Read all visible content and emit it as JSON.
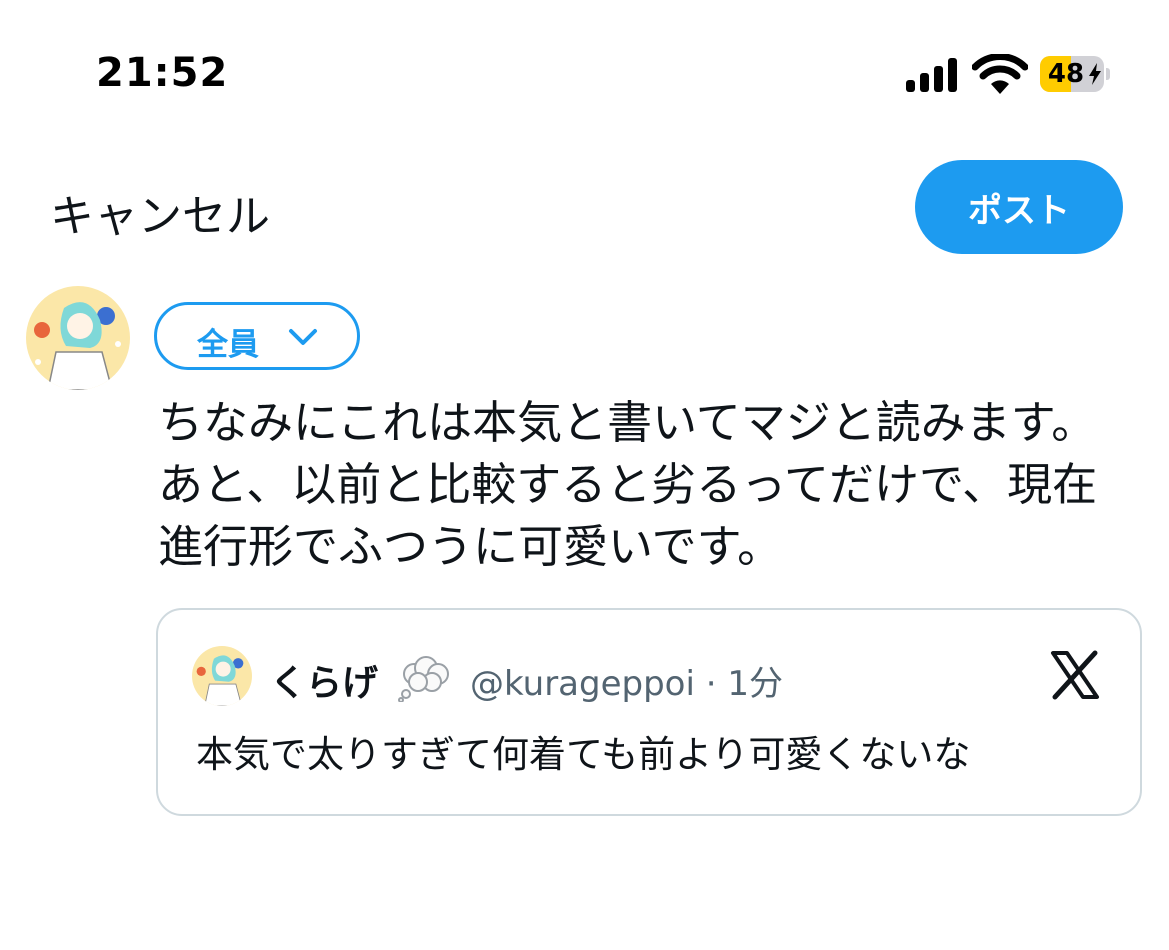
{
  "status_bar": {
    "time": "21:52",
    "battery_level": 48,
    "battery_text": "48",
    "battery_charging": true,
    "icons": [
      "cellular-signal-icon",
      "wifi-icon",
      "battery-icon",
      "charging-bolt-icon"
    ]
  },
  "nav": {
    "cancel_label": "キャンセル",
    "post_label": "ポスト"
  },
  "composer": {
    "audience_label": "全員",
    "text": "ちなみにこれは本気と書いてマジと読みます。あと、以前と比較すると劣るってだけで、現在進行形でふつうに可愛いです。"
  },
  "quoted_post": {
    "display_name": "くらげ",
    "name_emoji_icon": "thought-balloon-icon",
    "handle": "@kurageppoi",
    "separator": "·",
    "time_ago": "1分",
    "text": "本気で太りすぎて何着ても前より可愛くないな"
  },
  "colors": {
    "accent": "#1d9bf0",
    "text_primary": "#0f1419",
    "text_secondary": "#536471",
    "card_border": "#cfd9de",
    "battery_fill": "#ffcc00"
  }
}
